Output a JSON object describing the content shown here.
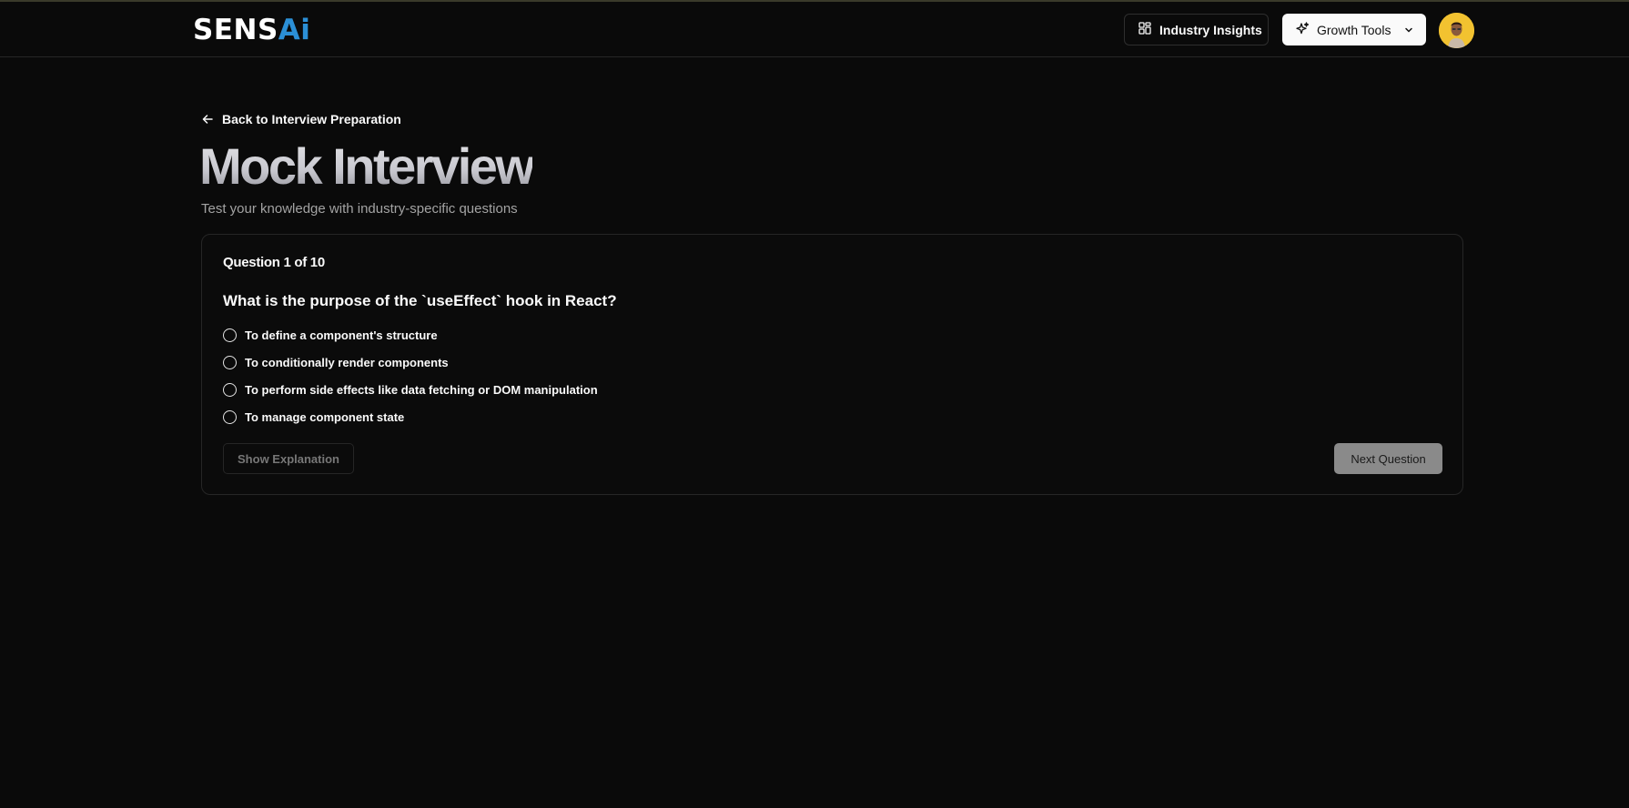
{
  "header": {
    "logo": {
      "part1": "SENS",
      "part2": "Ai"
    },
    "insights_label": "Industry Insights",
    "growth_label": "Growth Tools"
  },
  "nav": {
    "back_label": "Back to Interview Preparation"
  },
  "page": {
    "title": "Mock Interview",
    "subtitle": "Test your knowledge with industry-specific questions"
  },
  "quiz": {
    "counter": "Question 1 of 10",
    "question": "What is the purpose of the `useEffect` hook in React?",
    "options": [
      "To define a component's structure",
      "To conditionally render components",
      "To perform side effects like data fetching or DOM manipulation",
      "To manage component state"
    ],
    "explain_label": "Show Explanation",
    "next_label": "Next Question"
  },
  "colors": {
    "background": "#0a0a0a",
    "logo_accent": "#2b8fd6",
    "avatar_bg": "#f2c230"
  }
}
